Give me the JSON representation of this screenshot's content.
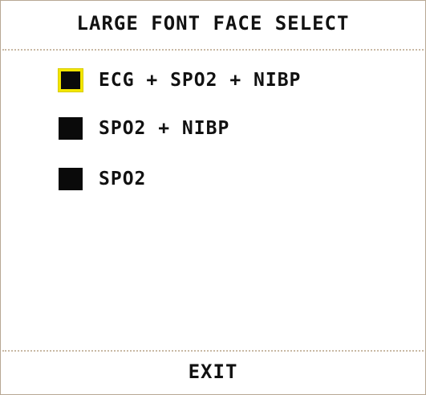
{
  "dialog": {
    "title": "LARGE FONT FACE SELECT",
    "options": [
      {
        "label": "ECG + SPO2 + NIBP",
        "selected": true
      },
      {
        "label": "SPO2 + NIBP",
        "selected": false
      },
      {
        "label": "SPO2",
        "selected": false
      }
    ],
    "exit_label": "EXIT"
  },
  "colors": {
    "border": "#b8a894",
    "divider": "#c9b9a4",
    "option_box": "#0a0a0a",
    "focus_highlight": "#f3e600",
    "text": "#111111"
  }
}
